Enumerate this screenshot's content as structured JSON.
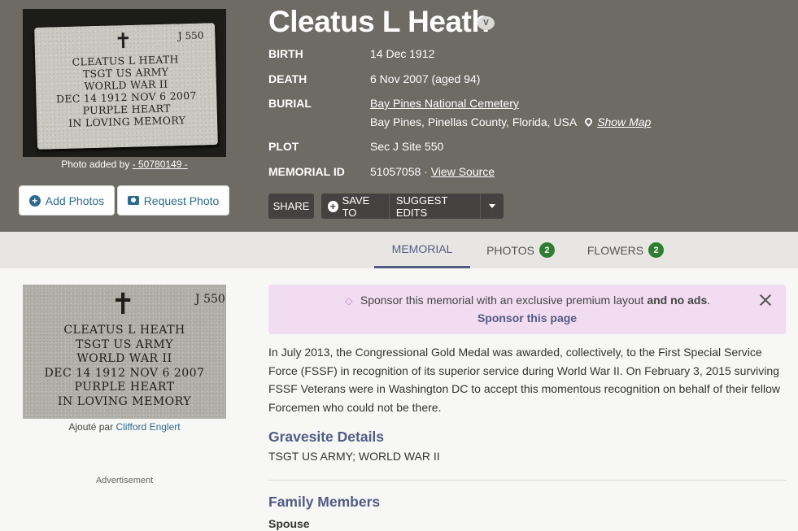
{
  "header": {
    "name": "Cleatus L Heath",
    "badge": "V",
    "photo_credit_prefix": "Photo added by",
    "photo_credit_user": "- 50780149 -",
    "add_photos": "Add Photos",
    "request_photo": "Request Photo",
    "headstone": {
      "cross": "✝",
      "number": "J  550",
      "lines": [
        "CLEATUS L HEATH",
        "TSGT   US ARMY",
        "WORLD WAR II",
        "DEC 14 1912     NOV 6 2007",
        "PURPLE HEART",
        "IN LOVING MEMORY"
      ]
    }
  },
  "facts": {
    "birth_label": "BIRTH",
    "birth_value": "14 Dec 1912",
    "death_label": "DEATH",
    "death_value": "6 Nov 2007 (aged 94)",
    "burial_label": "BURIAL",
    "burial_cemetery": "Bay Pines National Cemetery",
    "burial_location": "Bay Pines, Pinellas County, Florida, USA",
    "show_map": "Show Map",
    "plot_label": "PLOT",
    "plot_value": "Sec J Site 550",
    "memorial_label": "MEMORIAL ID",
    "memorial_value": "51057058 ·",
    "view_source": "View Source"
  },
  "actions": {
    "share": "SHARE",
    "save_to": "SAVE TO",
    "suggest_edits": "SUGGEST EDITS"
  },
  "tabs": [
    {
      "label": "MEMORIAL",
      "count": ""
    },
    {
      "label": "PHOTOS",
      "count": "2"
    },
    {
      "label": "FLOWERS",
      "count": "2"
    }
  ],
  "sidebar": {
    "added_by_prefix": "Ajouté par",
    "added_by_name": "Clifford Englert",
    "advertisement": "Advertisement",
    "headstone": {
      "cross": "✝",
      "number": "J  550",
      "lines": [
        "CLEATUS L HEATH",
        "TSGT   US ARMY",
        "WORLD WAR II",
        "DEC 14 1912     NOV 6 2007",
        "PURPLE HEART",
        "IN LOVING MEMORY"
      ]
    }
  },
  "sponsor": {
    "text_start": "Sponsor this memorial with an exclusive premium layout ",
    "text_bold": "and no ads",
    "text_end": ".",
    "link": "Sponsor this page"
  },
  "bio": "In July 2013, the Congressional Gold Medal was awarded, collectively, to the First Special Service Force (FSSF) in recognition of its superior service during World War II. On February 3, 2015 surviving FSSF Veterans were in Washington DC to accept this momentous recognition on behalf of their fellow Forcemen who could not be there.",
  "gravesite": {
    "heading": "Gravesite Details",
    "text": "TSGT US ARMY; WORLD WAR II"
  },
  "family": {
    "heading": "Family Members",
    "spouse_label": "Spouse"
  },
  "colors": {
    "header_bg": "#6e6a64",
    "accent": "#535b85",
    "link": "#2d6a8f",
    "badge_green": "#2e7d32",
    "sponsor_bg": "#f1dcf1"
  }
}
